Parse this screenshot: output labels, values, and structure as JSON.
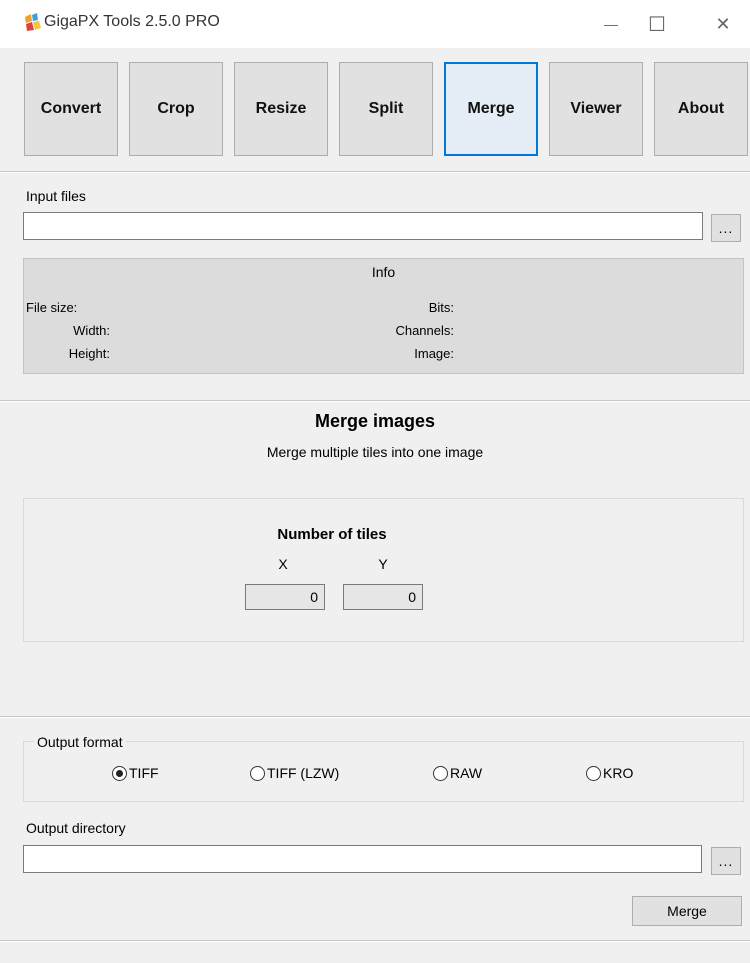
{
  "window": {
    "title": "GigaPX Tools 2.5.0 PRO",
    "minimize_glyph": "—",
    "maximize_glyph": "☐",
    "close_glyph": "✕"
  },
  "nav": {
    "items": [
      {
        "label": "Convert"
      },
      {
        "label": "Crop"
      },
      {
        "label": "Resize"
      },
      {
        "label": "Split"
      },
      {
        "label": "Merge",
        "active": true
      },
      {
        "label": "Viewer"
      },
      {
        "label": "About"
      }
    ]
  },
  "input": {
    "label": "Input files",
    "value": "",
    "browse_label": "..."
  },
  "info": {
    "title": "Info",
    "file_size_label": "File size:",
    "width_label": "Width:",
    "height_label": "Height:",
    "bits_label": "Bits:",
    "channels_label": "Channels:",
    "image_label": "Image:"
  },
  "merge": {
    "heading": "Merge images",
    "description": "Merge multiple tiles into one image",
    "tiles_heading": "Number of tiles",
    "x_label": "X",
    "y_label": "Y",
    "x_value": "0",
    "y_value": "0"
  },
  "output": {
    "format_label": "Output format",
    "formats": [
      {
        "label": "TIFF",
        "selected": true
      },
      {
        "label": "TIFF (LZW)",
        "selected": false
      },
      {
        "label": "RAW",
        "selected": false
      },
      {
        "label": "KRO",
        "selected": false
      }
    ],
    "directory_label": "Output directory",
    "directory_value": "",
    "browse_label": "...",
    "action_label": "Merge"
  },
  "colors": {
    "accent": "#0078d7",
    "background": "#f0f0f0",
    "info_panel": "#dcdcdc"
  }
}
